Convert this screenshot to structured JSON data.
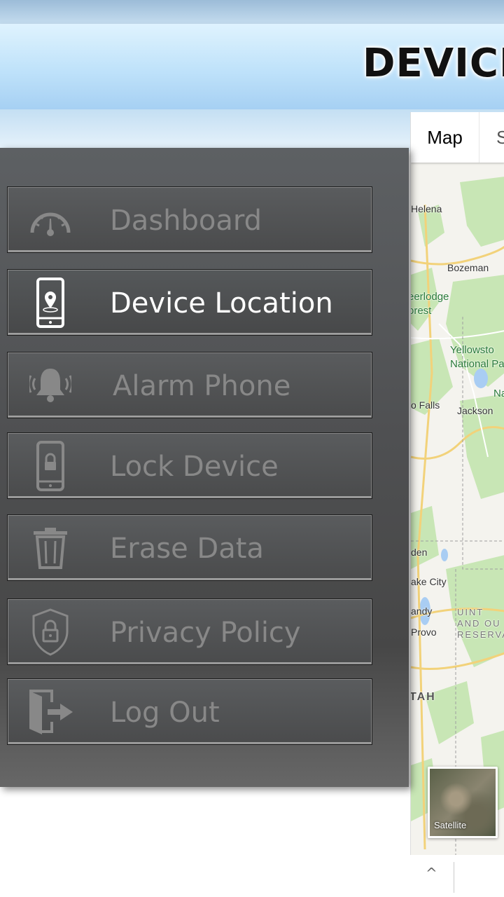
{
  "header": {
    "title": "DEVICE"
  },
  "map": {
    "tabs": [
      {
        "label": "Map",
        "active": true
      },
      {
        "label": "S",
        "active": false
      }
    ],
    "places": [
      {
        "name": "Helena",
        "kind": "city"
      },
      {
        "name": "Bozeman",
        "kind": "city"
      },
      {
        "name": "eerlodge\norest",
        "kind": "park"
      },
      {
        "name": "Yellowsto\nNational Pa",
        "kind": "park"
      },
      {
        "name": "Na",
        "kind": "park"
      },
      {
        "name": "o Falls",
        "kind": "city"
      },
      {
        "name": "Jackson",
        "kind": "city"
      },
      {
        "name": "den",
        "kind": "city"
      },
      {
        "name": "ake City",
        "kind": "city"
      },
      {
        "name": "andy",
        "kind": "city"
      },
      {
        "name": "Provo",
        "kind": "city"
      },
      {
        "name": "UINT\nAND OU\nRESERVA",
        "kind": "reservation"
      },
      {
        "name": "TAH",
        "kind": "state"
      }
    ],
    "satellite_label": "Satellite"
  },
  "drawer": {
    "items": [
      {
        "label": "Dashboard",
        "icon": "speedometer-icon",
        "active": false
      },
      {
        "label": "Device Location",
        "icon": "phone-location-icon",
        "active": true
      },
      {
        "label": "Alarm Phone",
        "icon": "bell-ringing-icon",
        "active": false
      },
      {
        "label": "Lock Device",
        "icon": "phone-lock-icon",
        "active": false
      },
      {
        "label": "Erase Data",
        "icon": "trash-icon",
        "active": false
      },
      {
        "label": "Privacy Policy",
        "icon": "shield-lock-icon",
        "active": false
      },
      {
        "label": "Log Out",
        "icon": "logout-door-icon",
        "active": false
      }
    ]
  },
  "colors": {
    "active_text": "#ffffff",
    "inactive_text": "#888888",
    "drawer_bg": "#505254",
    "header_bg": "#bfe2fa"
  },
  "nav": {
    "chevron": "^"
  }
}
